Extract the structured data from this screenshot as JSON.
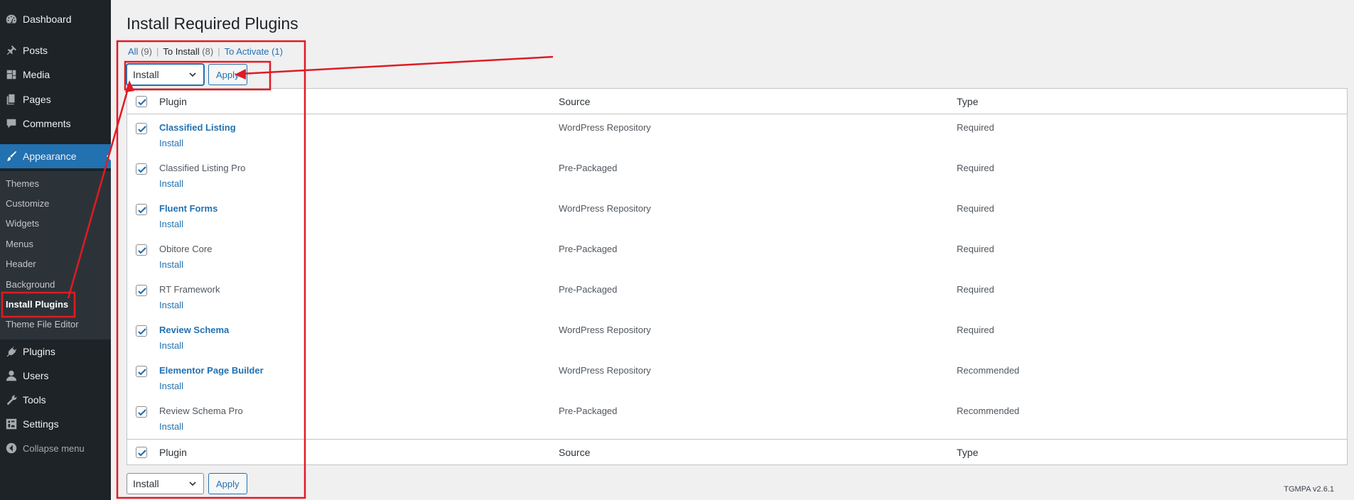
{
  "sidebar": {
    "items": [
      {
        "label": "Dashboard",
        "icon": "dashboard-icon"
      },
      {
        "label": "Posts",
        "icon": "pin-icon"
      },
      {
        "label": "Media",
        "icon": "media-icon"
      },
      {
        "label": "Pages",
        "icon": "pages-icon"
      },
      {
        "label": "Comments",
        "icon": "comment-icon"
      },
      {
        "label": "Appearance",
        "icon": "brush-icon"
      },
      {
        "label": "Plugins",
        "icon": "plug-icon"
      },
      {
        "label": "Users",
        "icon": "user-icon"
      },
      {
        "label": "Tools",
        "icon": "wrench-icon"
      },
      {
        "label": "Settings",
        "icon": "settings-icon"
      },
      {
        "label": "Collapse menu",
        "icon": "collapse-icon"
      }
    ],
    "submenu": [
      "Themes",
      "Customize",
      "Widgets",
      "Menus",
      "Header",
      "Background",
      "Install Plugins",
      "Theme File Editor"
    ]
  },
  "page": {
    "title": "Install Required Plugins",
    "filters": {
      "all": "All",
      "all_count": "(9)",
      "to_install": "To Install",
      "to_install_count": "(8)",
      "to_activate": "To Activate",
      "to_activate_count": "(1)",
      "sep": "|"
    },
    "bulk_action": {
      "selected": "Install",
      "apply": "Apply"
    },
    "columns": {
      "plugin": "Plugin",
      "source": "Source",
      "type": "Type"
    },
    "row_action": "Install",
    "rows": [
      {
        "name": "Classified Listing",
        "source": "WordPress Repository",
        "type": "Required",
        "linked": true
      },
      {
        "name": "Classified Listing Pro",
        "source": "Pre-Packaged",
        "type": "Required",
        "linked": false
      },
      {
        "name": "Fluent Forms",
        "source": "WordPress Repository",
        "type": "Required",
        "linked": true
      },
      {
        "name": "Obitore Core",
        "source": "Pre-Packaged",
        "type": "Required",
        "linked": false
      },
      {
        "name": "RT Framework",
        "source": "Pre-Packaged",
        "type": "Required",
        "linked": false
      },
      {
        "name": "Review Schema",
        "source": "WordPress Repository",
        "type": "Required",
        "linked": true
      },
      {
        "name": "Elementor Page Builder",
        "source": "WordPress Repository",
        "type": "Recommended",
        "linked": true
      },
      {
        "name": "Review Schema Pro",
        "source": "Pre-Packaged",
        "type": "Recommended",
        "linked": false
      }
    ],
    "version": "TGMPA v2.6.1"
  },
  "colors": {
    "sidebar_bg": "#1d2327",
    "accent": "#2271b1",
    "annotation": "#e01b24"
  }
}
